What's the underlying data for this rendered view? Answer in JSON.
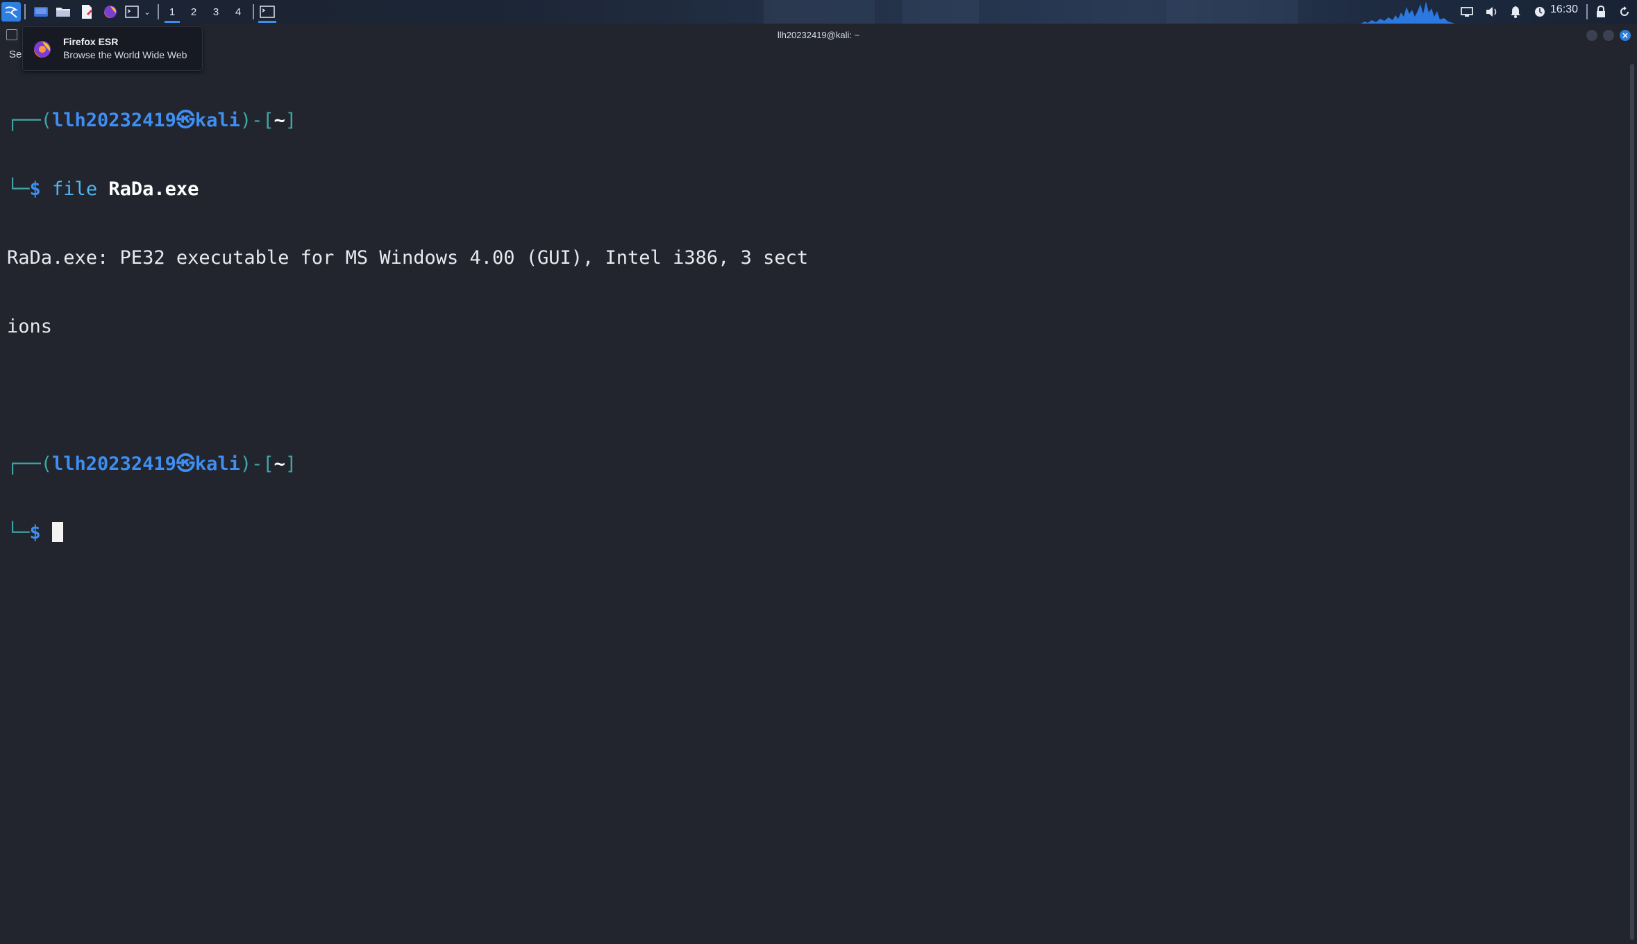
{
  "taskbar": {
    "launchers": [
      "kali-menu-icon",
      "desktop-icon",
      "file-manager-icon",
      "text-editor-icon",
      "firefox-icon",
      "terminal-icon"
    ],
    "workspaces": [
      "1",
      "2",
      "3",
      "4"
    ],
    "active_workspace": "1",
    "clock": "16:30",
    "tray_icons": [
      "display-icon",
      "volume-icon",
      "notification-bell-icon",
      "power-manager-icon",
      "lock-icon",
      "refresh-icon"
    ]
  },
  "tooltip": {
    "title": "Firefox ESR",
    "description": "Browse the World Wide Web"
  },
  "window": {
    "title": "llh20232419@kali: ~",
    "menu_label_fragment": "Se"
  },
  "terminal": {
    "prompt1": {
      "open": "┌──(",
      "user": "llh20232419",
      "at": "㉿",
      "host": "kali",
      "mid": ")-[",
      "path": "~",
      "close": "]",
      "corner": "└─",
      "dollar": "$",
      "command": "file",
      "argument": "RaDa.exe"
    },
    "output": [
      "RaDa.exe: PE32 executable for MS Windows 4.00 (GUI), Intel i386, 3 sect",
      "ions"
    ],
    "prompt2": {
      "open": "┌──(",
      "user": "llh20232419",
      "at": "㉿",
      "host": "kali",
      "mid": ")-[",
      "path": "~",
      "close": "]",
      "corner": "└─",
      "dollar": "$"
    }
  },
  "colors": {
    "accent": "#3c8ff0",
    "prompt_teal": "#3fa7a6",
    "prompt_blue": "#3f8ff2",
    "background": "#22252e"
  }
}
